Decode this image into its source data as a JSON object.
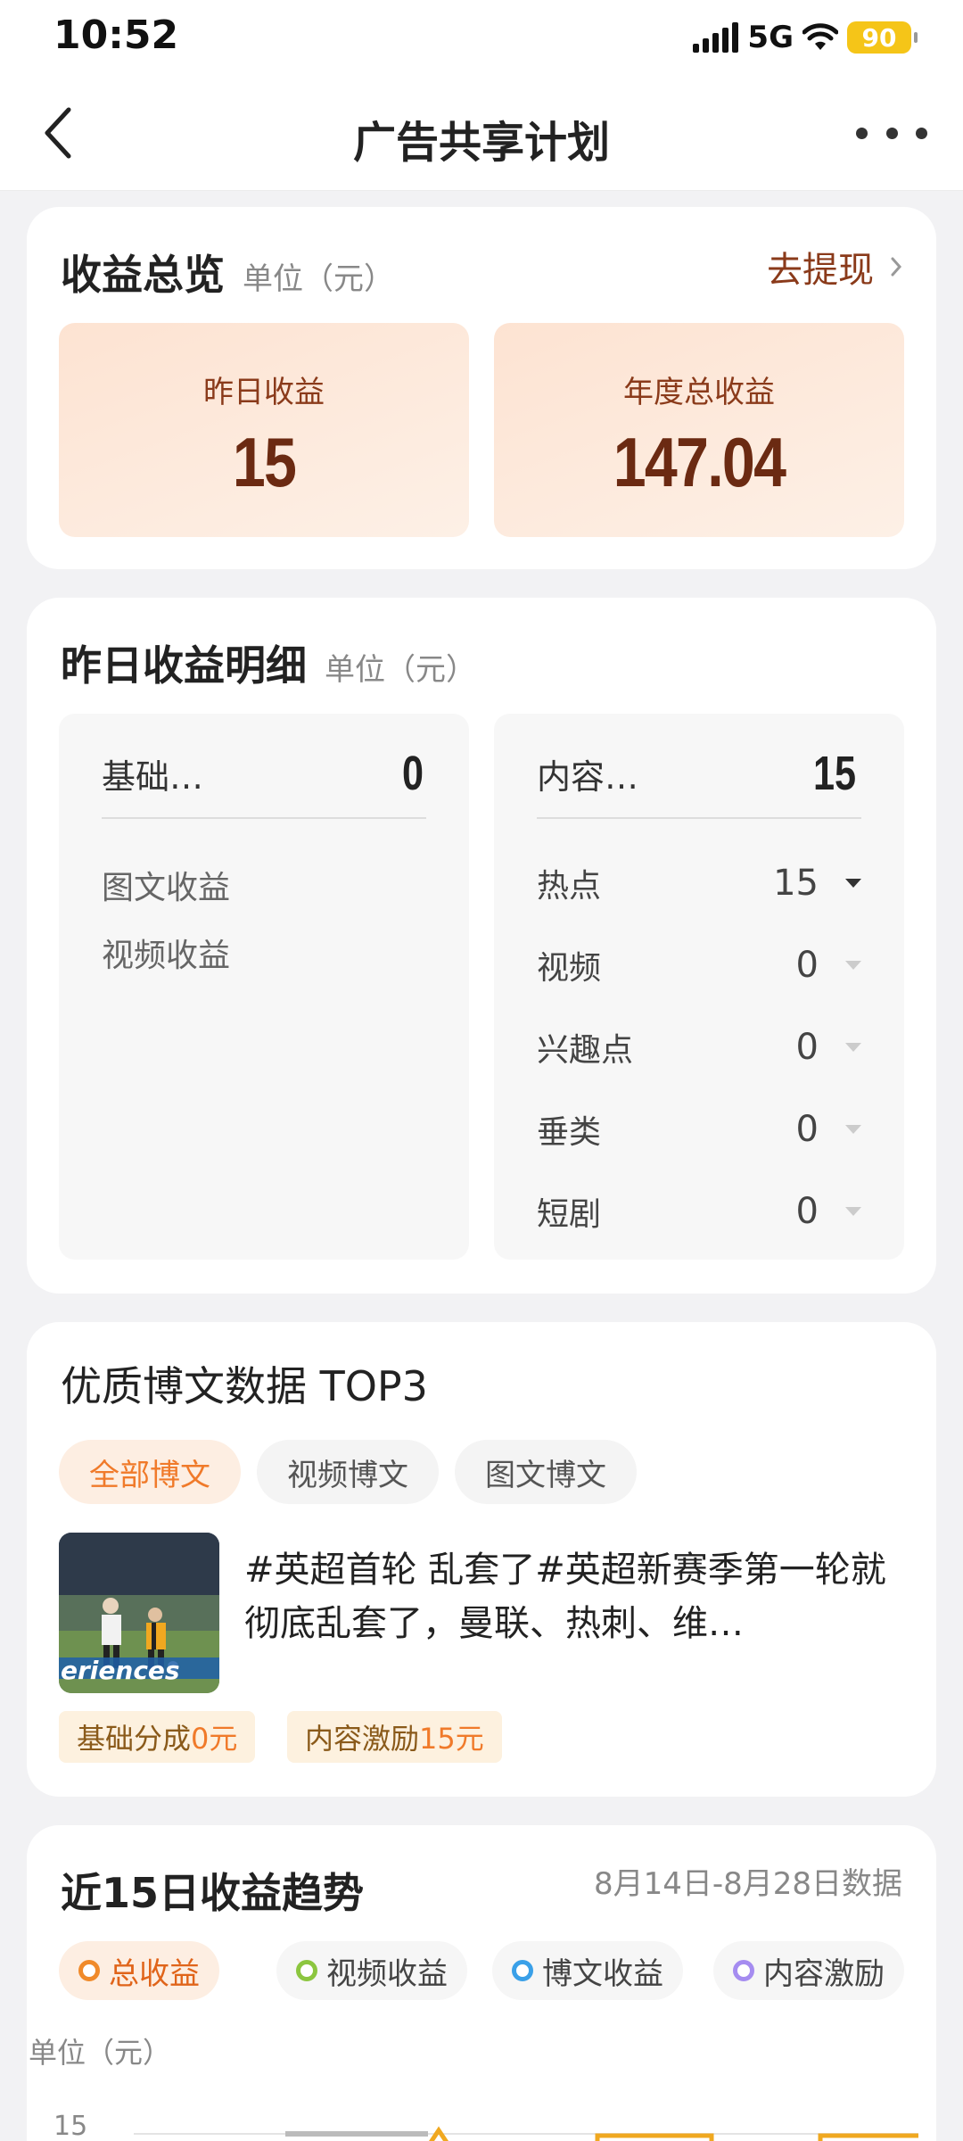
{
  "status": {
    "time": "10:52",
    "network": "5G",
    "battery": "90"
  },
  "nav": {
    "title": "广告共享计划"
  },
  "overview": {
    "title": "收益总览",
    "unit": "单位（元）",
    "withdraw_label": "去提现",
    "yesterday_label": "昨日收益",
    "yesterday_value": "15",
    "annual_label": "年度总收益",
    "annual_value": "147.04"
  },
  "detail": {
    "title": "昨日收益明细",
    "unit": "单位（元）",
    "basic": {
      "label": "基础…",
      "value": "0",
      "items": [
        "图文收益",
        "视频收益"
      ]
    },
    "content": {
      "label": "内容…",
      "value": "15",
      "items": [
        {
          "label": "热点",
          "value": "15"
        },
        {
          "label": "视频",
          "value": "0"
        },
        {
          "label": "兴趣点",
          "value": "0"
        },
        {
          "label": "垂类",
          "value": "0"
        },
        {
          "label": "短剧",
          "value": "0"
        }
      ]
    }
  },
  "top3": {
    "title": "优质博文数据 TOP3",
    "tabs": [
      "全部博文",
      "视频博文",
      "图文博文"
    ],
    "post": {
      "text": "#英超首轮 乱套了#英超新赛季第一轮就彻底乱套了，曼联、热刺、维…",
      "thumb_text": "eriences",
      "tag1_prefix": "基础分成",
      "tag1_value": "0元",
      "tag2_prefix": "内容激励",
      "tag2_value": "15元"
    }
  },
  "trend": {
    "title": "近15日收益趋势",
    "range": "8月14日-8月28日数据",
    "legends": [
      {
        "label": "总收益",
        "color": "#f08a2a"
      },
      {
        "label": "视频收益",
        "color": "#8cc63f"
      },
      {
        "label": "博文收益",
        "color": "#3aa0e8"
      },
      {
        "label": "内容激励",
        "color": "#a58cf0"
      }
    ],
    "y_unit": "单位（元）",
    "y_tick": "15"
  }
}
